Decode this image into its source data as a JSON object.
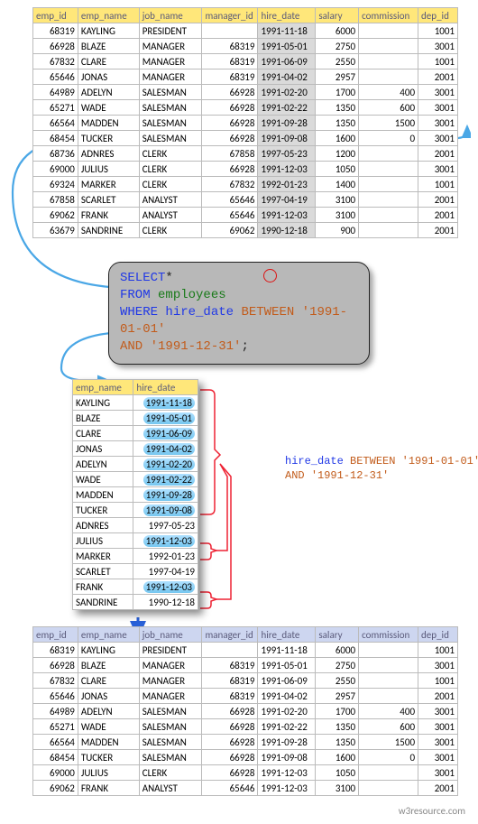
{
  "columns": [
    "emp_id",
    "emp_name",
    "job_name",
    "manager_id",
    "hire_date",
    "salary",
    "commission",
    "dep_id"
  ],
  "employees": [
    {
      "emp_id": 68319,
      "emp_name": "KAYLING",
      "job_name": "PRESIDENT",
      "manager_id": "",
      "hire_date": "1991-11-18",
      "salary": 6000,
      "commission": "",
      "dep_id": 1001,
      "hl": true
    },
    {
      "emp_id": 66928,
      "emp_name": "BLAZE",
      "job_name": "MANAGER",
      "manager_id": 68319,
      "hire_date": "1991-05-01",
      "salary": 2750,
      "commission": "",
      "dep_id": 3001,
      "hl": true
    },
    {
      "emp_id": 67832,
      "emp_name": "CLARE",
      "job_name": "MANAGER",
      "manager_id": 68319,
      "hire_date": "1991-06-09",
      "salary": 2550,
      "commission": "",
      "dep_id": 1001,
      "hl": true
    },
    {
      "emp_id": 65646,
      "emp_name": "JONAS",
      "job_name": "MANAGER",
      "manager_id": 68319,
      "hire_date": "1991-04-02",
      "salary": 2957,
      "commission": "",
      "dep_id": 2001,
      "hl": true
    },
    {
      "emp_id": 64989,
      "emp_name": "ADELYN",
      "job_name": "SALESMAN",
      "manager_id": 66928,
      "hire_date": "1991-02-20",
      "salary": 1700,
      "commission": 400,
      "dep_id": 3001,
      "hl": true
    },
    {
      "emp_id": 65271,
      "emp_name": "WADE",
      "job_name": "SALESMAN",
      "manager_id": 66928,
      "hire_date": "1991-02-22",
      "salary": 1350,
      "commission": 600,
      "dep_id": 3001,
      "hl": true
    },
    {
      "emp_id": 66564,
      "emp_name": "MADDEN",
      "job_name": "SALESMAN",
      "manager_id": 66928,
      "hire_date": "1991-09-28",
      "salary": 1350,
      "commission": 1500,
      "dep_id": 3001,
      "hl": true
    },
    {
      "emp_id": 68454,
      "emp_name": "TUCKER",
      "job_name": "SALESMAN",
      "manager_id": 66928,
      "hire_date": "1991-09-08",
      "salary": 1600,
      "commission": 0,
      "dep_id": 3001,
      "hl": true
    },
    {
      "emp_id": 68736,
      "emp_name": "ADNRES",
      "job_name": "CLERK",
      "manager_id": 67858,
      "hire_date": "1997-05-23",
      "salary": 1200,
      "commission": "",
      "dep_id": 2001,
      "hl": false
    },
    {
      "emp_id": 69000,
      "emp_name": "JULIUS",
      "job_name": "CLERK",
      "manager_id": 66928,
      "hire_date": "1991-12-03",
      "salary": 1050,
      "commission": "",
      "dep_id": 3001,
      "hl": true
    },
    {
      "emp_id": 69324,
      "emp_name": "MARKER",
      "job_name": "CLERK",
      "manager_id": 67832,
      "hire_date": "1992-01-23",
      "salary": 1400,
      "commission": "",
      "dep_id": 1001,
      "hl": false
    },
    {
      "emp_id": 67858,
      "emp_name": "SCARLET",
      "job_name": "ANALYST",
      "manager_id": 65646,
      "hire_date": "1997-04-19",
      "salary": 3100,
      "commission": "",
      "dep_id": 2001,
      "hl": false
    },
    {
      "emp_id": 69062,
      "emp_name": "FRANK",
      "job_name": "ANALYST",
      "manager_id": 65646,
      "hire_date": "1991-12-03",
      "salary": 3100,
      "commission": "",
      "dep_id": 2001,
      "hl": true
    },
    {
      "emp_id": 63679,
      "emp_name": "SANDRINE",
      "job_name": "CLERK",
      "manager_id": 69062,
      "hire_date": "1990-12-18",
      "salary": 900,
      "commission": "",
      "dep_id": 2001,
      "hl": false
    }
  ],
  "sql": {
    "select": "SELECT",
    "star": "*",
    "from": "FROM",
    "table": "employees",
    "where": "WHERE",
    "col": "hire_date",
    "between": "BETWEEN",
    "v1": "'1991-01-01'",
    "and": "AND",
    "v2": "'1991-12-31'",
    "semi": ";"
  },
  "mid_columns": [
    "emp_name",
    "hire_date"
  ],
  "annotation": {
    "line1a": "hire_date",
    "line1b": "BETWEEN",
    "line1c": "'1991-01-01'",
    "line2a": "AND",
    "line2b": "'1991-12-31'"
  },
  "result": [
    {
      "emp_id": 68319,
      "emp_name": "KAYLING",
      "job_name": "PRESIDENT",
      "manager_id": "",
      "hire_date": "1991-11-18",
      "salary": 6000,
      "commission": "",
      "dep_id": 1001
    },
    {
      "emp_id": 66928,
      "emp_name": "BLAZE",
      "job_name": "MANAGER",
      "manager_id": 68319,
      "hire_date": "1991-05-01",
      "salary": 2750,
      "commission": "",
      "dep_id": 3001
    },
    {
      "emp_id": 67832,
      "emp_name": "CLARE",
      "job_name": "MANAGER",
      "manager_id": 68319,
      "hire_date": "1991-06-09",
      "salary": 2550,
      "commission": "",
      "dep_id": 1001
    },
    {
      "emp_id": 65646,
      "emp_name": "JONAS",
      "job_name": "MANAGER",
      "manager_id": 68319,
      "hire_date": "1991-04-02",
      "salary": 2957,
      "commission": "",
      "dep_id": 2001
    },
    {
      "emp_id": 64989,
      "emp_name": "ADELYN",
      "job_name": "SALESMAN",
      "manager_id": 66928,
      "hire_date": "1991-02-20",
      "salary": 1700,
      "commission": 400,
      "dep_id": 3001
    },
    {
      "emp_id": 65271,
      "emp_name": "WADE",
      "job_name": "SALESMAN",
      "manager_id": 66928,
      "hire_date": "1991-02-22",
      "salary": 1350,
      "commission": 600,
      "dep_id": 3001
    },
    {
      "emp_id": 66564,
      "emp_name": "MADDEN",
      "job_name": "SALESMAN",
      "manager_id": 66928,
      "hire_date": "1991-09-28",
      "salary": 1350,
      "commission": 1500,
      "dep_id": 3001
    },
    {
      "emp_id": 68454,
      "emp_name": "TUCKER",
      "job_name": "SALESMAN",
      "manager_id": 66928,
      "hire_date": "1991-09-08",
      "salary": 1600,
      "commission": 0,
      "dep_id": 3001
    },
    {
      "emp_id": 69000,
      "emp_name": "JULIUS",
      "job_name": "CLERK",
      "manager_id": 66928,
      "hire_date": "1991-12-03",
      "salary": 1050,
      "commission": "",
      "dep_id": 3001
    },
    {
      "emp_id": 69062,
      "emp_name": "FRANK",
      "job_name": "ANALYST",
      "manager_id": 65646,
      "hire_date": "1991-12-03",
      "salary": 3100,
      "commission": "",
      "dep_id": 2001
    }
  ],
  "footer": "w3resource.com"
}
